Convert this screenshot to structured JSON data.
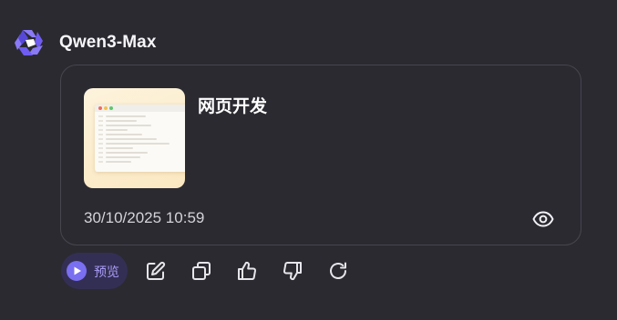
{
  "assistant": {
    "model_name": "Qwen3-Max",
    "logo_icon": "qwen-logo-icon",
    "brand_color": "#6f5cf1"
  },
  "card": {
    "title": "网页开发",
    "timestamp": "30/10/2025 10:59",
    "thumbnail_icon": "code-page-thumbnail",
    "preview_icon": "eye-icon"
  },
  "actions": {
    "preview_label": "预览",
    "preview_icon": "play-circle-icon",
    "accent_color": "#7a6ff0",
    "buttons": [
      {
        "name": "edit",
        "icon": "edit-icon"
      },
      {
        "name": "copy",
        "icon": "copy-icon"
      },
      {
        "name": "like",
        "icon": "thumbs-up-icon"
      },
      {
        "name": "dislike",
        "icon": "thumbs-down-icon"
      },
      {
        "name": "regenerate",
        "icon": "refresh-icon"
      }
    ]
  }
}
